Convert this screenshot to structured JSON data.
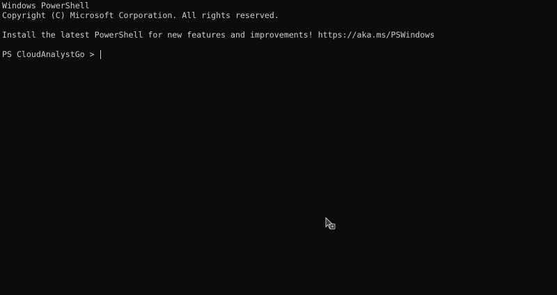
{
  "terminal": {
    "lines": [
      "Windows PowerShell",
      "Copyright (C) Microsoft Corporation. All rights reserved.",
      "Install the latest PowerShell for new features and improvements! https://aka.ms/PSWindows"
    ],
    "prompt": "PS CloudAnalystGo > "
  },
  "colors": {
    "background": "#0c0c0e",
    "foreground": "#cccccc"
  },
  "icons": {
    "pointer": "busy-pointer-icon"
  }
}
